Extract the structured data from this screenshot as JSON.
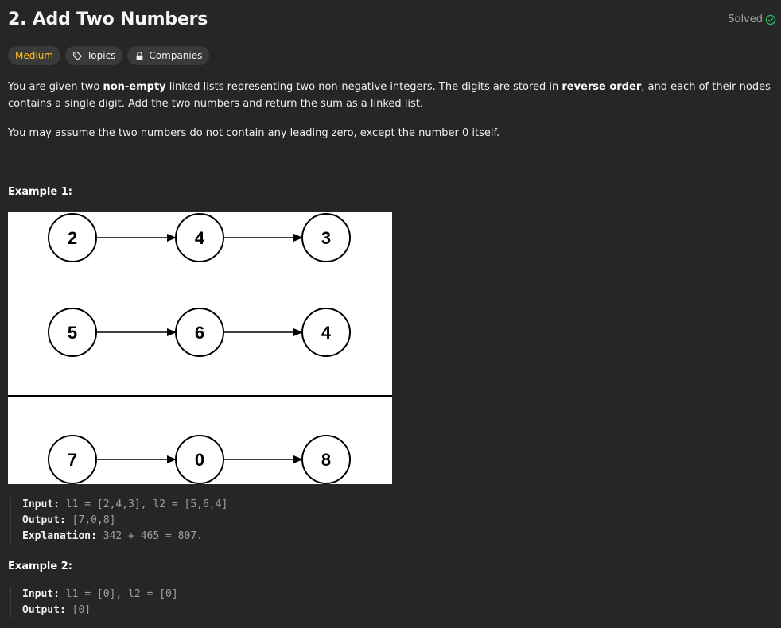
{
  "problem": {
    "title": "2. Add Two Numbers",
    "status": "Solved",
    "difficulty": "Medium",
    "tags": [
      "Topics",
      "Companies"
    ]
  },
  "description": {
    "p1_a": "You are given two ",
    "p1_b": "non-empty",
    "p1_c": " linked lists representing two non-negative integers. The digits are stored in ",
    "p1_d": "reverse order",
    "p1_e": ", and each of their nodes contains a single digit. Add the two numbers and return the sum as a linked list.",
    "p2": "You may assume the two numbers do not contain any leading zero, except the number 0 itself."
  },
  "example1": {
    "title": "Example 1:",
    "diagram": {
      "list1": [
        "2",
        "4",
        "3"
      ],
      "list2": [
        "5",
        "6",
        "4"
      ],
      "result": [
        "7",
        "0",
        "8"
      ]
    },
    "input_label": "Input:",
    "input_value": "l1 = [2,4,3], l2 = [5,6,4]",
    "output_label": "Output:",
    "output_value": "[7,0,8]",
    "explanation_label": "Explanation:",
    "explanation_value": "342 + 465 = 807."
  },
  "example2": {
    "title": "Example 2:",
    "input_label": "Input:",
    "input_value": "l1 = [0], l2 = [0]",
    "output_label": "Output:",
    "output_value": "[0]"
  },
  "colors": {
    "background": "#262626",
    "difficulty_medium": "#ffc01e",
    "solved_green": "#2cbb5d",
    "tag_bg": "#3a3a3a"
  }
}
